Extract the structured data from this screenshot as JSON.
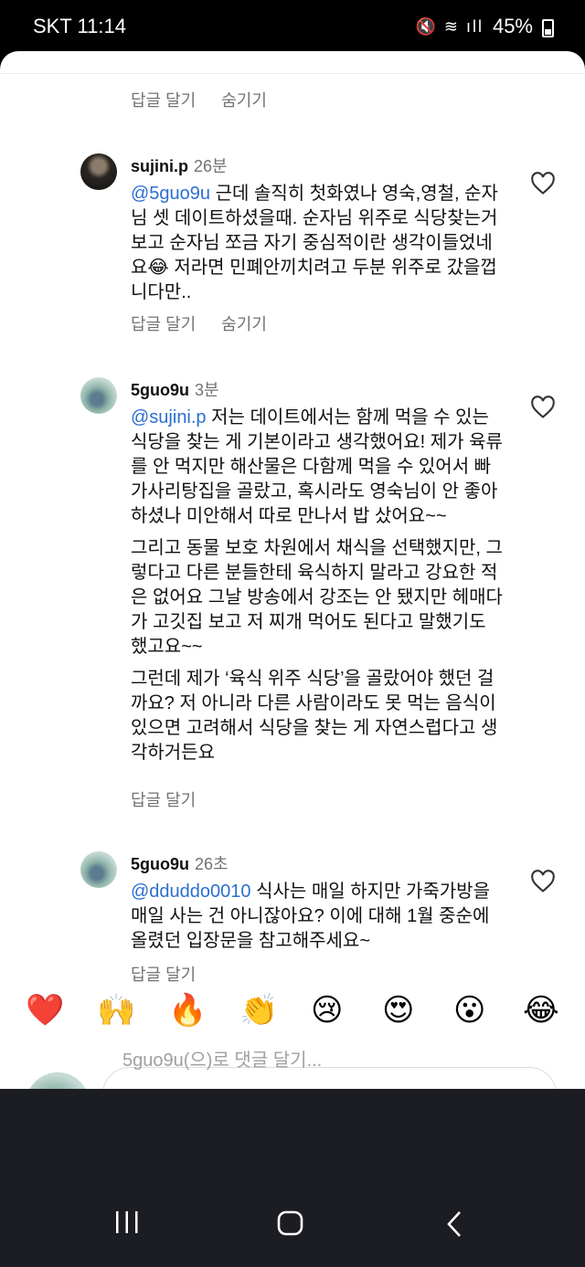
{
  "status_bar": {
    "carrier": "SKT",
    "time": "11:14",
    "battery": "45%"
  },
  "top_actions": {
    "reply": "답글 달기",
    "hide": "숨기기"
  },
  "comments": [
    {
      "username": "sujini.p",
      "time": "26분",
      "mention": "@5guo9u",
      "text": " 근데 솔직히 첫화였나 영숙,영철, 순자님 셋 데이트하셨을때. 순자님 위주로 식당찾는거보고 순자님  쪼금 자기  중심적이란 생각이들었네요",
      "emoji": "😂",
      "text_after_emoji": "   저라면 민폐안끼치려고 두분 위주로 갔을껍니다만..",
      "reply": "답글 달기",
      "hide": "숨기기"
    },
    {
      "username": "5guo9u",
      "time": "3분",
      "mention": "@sujini.p",
      "paragraph1": " 저는 데이트에서는 함께 먹을 수 있는 식당을 찾는 게 기본이라고 생각했어요! 제가 육류를 안 먹지만 해산물은 다함께 먹을 수 있어서 빠가사리탕집을 골랐고, 혹시라도 영숙님이 안 좋아하셨나 미안해서 따로 만나서 밥 샀어요~~",
      "paragraph2": "그리고 동물 보호 차원에서 채식을 선택했지만, 그렇다고 다른 분들한테 육식하지 말라고 강요한 적은 없어요 그날 방송에서 강조는 안 됐지만 헤매다가 고깃집 보고 저 찌개 먹어도 된다고 말했기도 했고요~~",
      "paragraph3": "그런데 제가 ‘육식 위주 식당’을 골랐어야 했던 걸까요? 저 아니라 다른 사람이라도 못 먹는 음식이 있으면 고려해서 식당을 찾는 게 자연스럽다고 생각하거든요",
      "reply": "답글 달기"
    },
    {
      "username": "5guo9u",
      "time": "26초",
      "mention": "@dduddo0010",
      "text": " 식사는 매일 하지만 가죽가방을 매일 사는 건 아니잖아요? 이에 대해 1월 중순에 올렸던 입장문을 참고해주세요~",
      "reply": "답글 달기"
    }
  ],
  "reactions": [
    "❤️",
    "🙌",
    "🔥",
    "👏",
    "😢",
    "😍",
    "😮",
    "😂"
  ],
  "comment_input": {
    "placeholder": "5guo9u(으)로 댓글 달기..."
  },
  "icons": {
    "like": "heart-outline-icon",
    "nav_recents": "recent-apps-icon",
    "nav_home": "home-icon",
    "nav_back": "back-icon"
  }
}
